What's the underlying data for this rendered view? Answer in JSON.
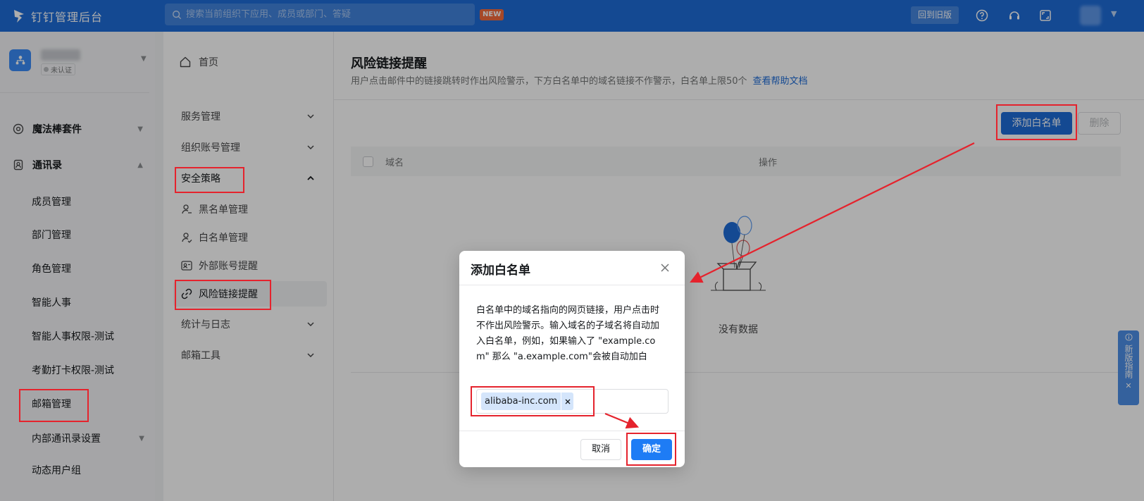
{
  "header": {
    "app_title": "钉钉管理后台",
    "search_placeholder": "搜索当前组织下应用、成员或部门、答疑",
    "new_badge": "NEW",
    "back_old_label": "回到旧版",
    "icons": [
      "help-icon",
      "headset-icon",
      "fullscreen-icon"
    ]
  },
  "org": {
    "status": "未认证"
  },
  "sidebar": {
    "groups": [
      {
        "label": "魔法棒套件",
        "icon": "magic-icon",
        "expanded": false
      },
      {
        "label": "通讯录",
        "icon": "contacts-icon",
        "expanded": true
      }
    ],
    "items": [
      {
        "label": "成员管理"
      },
      {
        "label": "部门管理"
      },
      {
        "label": "角色管理"
      },
      {
        "label": "智能人事"
      },
      {
        "label": "智能人事权限-测试"
      },
      {
        "label": "考勤打卡权限-测试"
      },
      {
        "label": "邮箱管理"
      },
      {
        "label": "内部通讯录设置"
      },
      {
        "label": "动态用户组"
      }
    ]
  },
  "subnav": {
    "home": "首页",
    "groups": [
      {
        "label": "服务管理"
      },
      {
        "label": "组织账号管理"
      },
      {
        "label": "安全策略"
      },
      {
        "label": "统计与日志"
      },
      {
        "label": "邮箱工具"
      }
    ],
    "security_items": [
      {
        "label": "黑名单管理"
      },
      {
        "label": "白名单管理"
      },
      {
        "label": "外部账号提醒"
      },
      {
        "label": "风险链接提醒"
      }
    ]
  },
  "main": {
    "title": "风险链接提醒",
    "description": "用户点击邮件中的链接跳转时作出风险警示，下方白名单中的域名链接不作警示，白名单上限50个",
    "help_link": "查看帮助文档",
    "add_button": "添加白名单",
    "delete_button": "删除",
    "columns": [
      "域名",
      "操作"
    ],
    "empty_text": "没有数据"
  },
  "guide": {
    "label": "新版指南"
  },
  "dialog": {
    "title": "添加白名单",
    "body": "白名单中的域名指向的网页链接，用户点击时不作出风险警示。输入域名的子域名将自动加入白名单，例如，如果输入了 \"example.com\" 那么 \"a.example.com\"会被自动加白",
    "tags": [
      "alibaba-inc.com"
    ],
    "cancel_label": "取消",
    "ok_label": "确定"
  },
  "colors": {
    "brand": "#1e6cd8",
    "annotation": "#e5232d"
  }
}
